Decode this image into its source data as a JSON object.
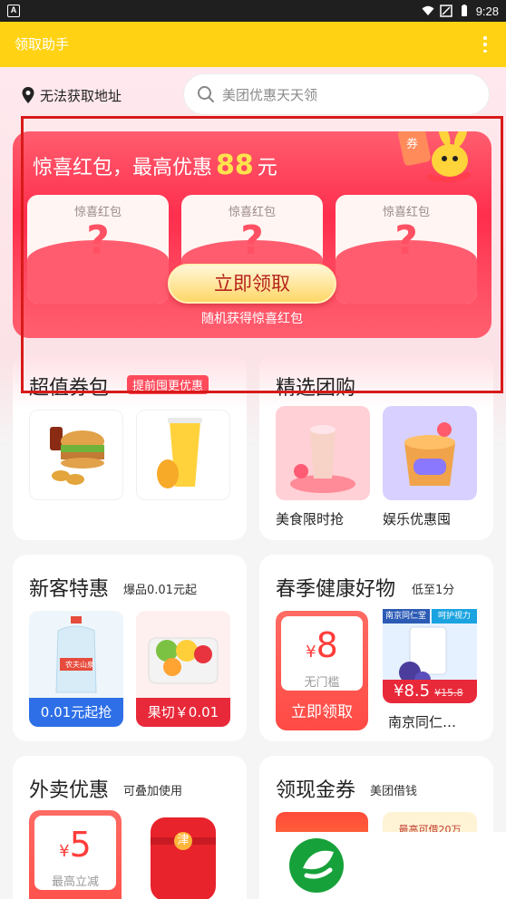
{
  "status_bar": {
    "time": "9:28",
    "app_badge": "A"
  },
  "app_bar": {
    "title": "领取助手"
  },
  "location": {
    "label": "无法获取地址"
  },
  "search": {
    "placeholder": "美团优惠天天领"
  },
  "banner": {
    "title_prefix": "惊喜红包，最高优惠",
    "amount": "88",
    "title_suffix": "元",
    "packet_label": "惊喜红包",
    "packet_mark": "?",
    "claim_button": "立即领取",
    "subtitle": "随机获得惊喜红包",
    "voucher_badge": "券"
  },
  "coupon_pack": {
    "title": "超值券包",
    "tag": "提前囤更优惠"
  },
  "group_buy": {
    "title": "精选团购",
    "items": [
      {
        "label": "美食限时抢"
      },
      {
        "label": "娱乐优惠囤"
      }
    ]
  },
  "new_customer": {
    "title": "新客特惠",
    "subtitle": "爆品0.01元起",
    "items": [
      {
        "price": "0.01元起抢",
        "bottle_brand": "农夫山泉"
      },
      {
        "price": "果切￥0.01"
      }
    ]
  },
  "spring_health": {
    "title": "春季健康好物",
    "subtitle": "低至1分",
    "coupon": {
      "currency": "¥",
      "value": "8",
      "note": "无门槛",
      "button": "立即领取"
    },
    "product": {
      "brand": "南京同仁堂",
      "label": "呵护视力",
      "price": "¥8.5",
      "original_price": "¥15.8",
      "name": "南京同仁…"
    }
  },
  "takeout": {
    "title": "外卖优惠",
    "subtitle": "可叠加使用",
    "coupon": {
      "currency": "¥",
      "value": "5",
      "note": "最高立减"
    },
    "bag_mark": "津"
  },
  "cash_coupon": {
    "title": "领现金券",
    "subtitle": "美团借钱",
    "promo": "最高可借20万"
  },
  "colors": {
    "app_bar": "#ffd314",
    "accent_red": "#ff4b5c",
    "highlight_box": "#d81a1a",
    "amount_yellow": "#ffe34d"
  }
}
